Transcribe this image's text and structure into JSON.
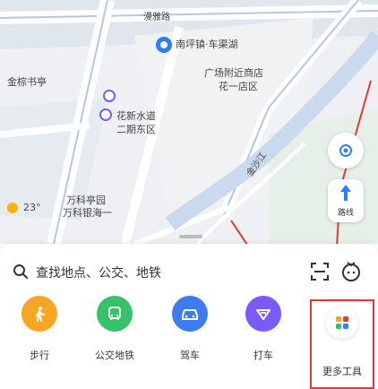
{
  "map": {
    "labels": {
      "road_top": "漫雅路",
      "poi_pin_name": "南坪镇·车渠湖",
      "poi_pin_area": "广场附近商店",
      "poi_pin_sub": "花一店区",
      "left_name": "金棕书亭",
      "poi_left2": "花新水道",
      "poi_left3": "二期东区",
      "road_diag": "金沙江",
      "weather": "23°",
      "weather_place": "万科亭园",
      "weather_sub": "万科银海一",
      "right_badge": "路线"
    }
  },
  "sheet": {
    "search_placeholder": "查找地点、公交、地铁"
  },
  "modes": [
    {
      "label": "步行",
      "color": "#f5a623",
      "icon": "walk-icon"
    },
    {
      "label": "公交地铁",
      "color": "#35c26a",
      "icon": "bus-icon"
    },
    {
      "label": "驾车",
      "color": "#3d7cf0",
      "icon": "car-icon"
    },
    {
      "label": "打车",
      "color": "#7a5af8",
      "icon": "taxi-icon"
    }
  ],
  "tool": {
    "label": "更多工具",
    "icon": "grid-icon"
  }
}
